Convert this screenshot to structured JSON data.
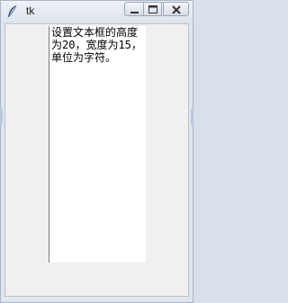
{
  "window": {
    "title": "tk",
    "icon": "feather-icon",
    "controls": [
      "minimize-icon",
      "maximize-icon",
      "close-icon"
    ]
  },
  "textbox": {
    "content": "设置文本框的高度为20，宽度为15，单位为字符。"
  }
}
